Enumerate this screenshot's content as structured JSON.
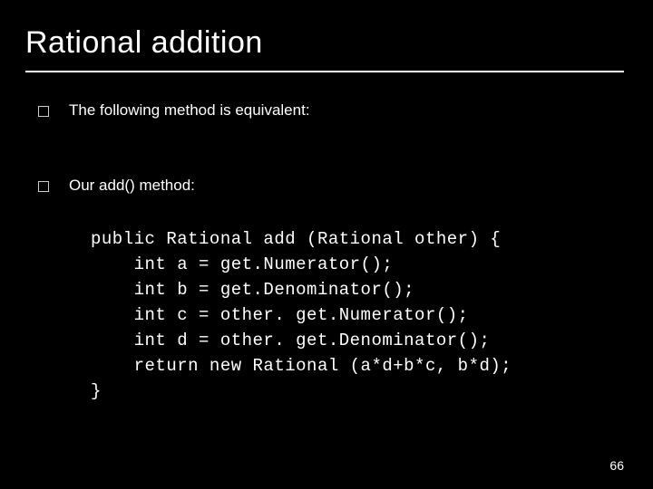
{
  "title": "Rational addition",
  "bullets": [
    "The following method is equivalent:",
    "Our add() method:"
  ],
  "code": {
    "l1": "public Rational add (Rational other) {",
    "l2": "    int a = get.Numerator();",
    "l3": "    int b = get.Denominator();",
    "l4": "    int c = other. get.Numerator();",
    "l5": "    int d = other. get.Denominator();",
    "l6": "    return new Rational (a*d+b*c, b*d);",
    "l7": "}"
  },
  "page_number": "66"
}
